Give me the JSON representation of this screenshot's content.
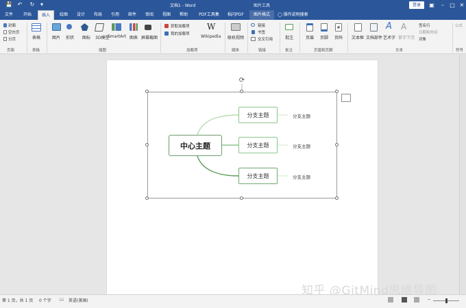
{
  "window": {
    "doc_title": "文档1 - Word",
    "tools_title": "图片工具",
    "login_label": "登录"
  },
  "tabs": [
    "文件",
    "开始",
    "插入",
    "绘图",
    "设计",
    "布局",
    "引用",
    "邮件",
    "审阅",
    "视图",
    "帮助",
    "PDF工具集",
    "稻闪PDF",
    "图片格式",
    "操作说明搜索"
  ],
  "ribbon": {
    "pages": {
      "cover": "封面",
      "blank": "空白页",
      "break": "分页",
      "label": "页面"
    },
    "tables": {
      "table": "表格",
      "label": "表格"
    },
    "illustrations": {
      "picture": "图片",
      "shapes": "形状",
      "icons": "图标",
      "model3d": "3D模型",
      "smartart": "SmartArt",
      "chart": "图表",
      "screenshot": "屏幕截图",
      "label": "插图"
    },
    "addins": {
      "get": "获取加载项",
      "mine": "我的加载项",
      "wiki": "Wikipedia",
      "label": "加载项"
    },
    "media": {
      "video": "联机视频",
      "label": "媒体"
    },
    "links": {
      "link": "链接",
      "bookmark": "书签",
      "crossref": "交叉引用",
      "label": "链接"
    },
    "comments": {
      "comment": "批注",
      "label": "批注"
    },
    "header_footer": {
      "header": "页眉",
      "footer": "页脚",
      "page_number": "页码",
      "label": "页眉和页脚"
    },
    "text": {
      "textbox": "文本框",
      "quickparts": "文档部件",
      "wordart": "艺术字",
      "dropcap": "首字下沉",
      "signature": "签名行",
      "datetime": "日期和时间",
      "object": "对象",
      "label": "文本"
    },
    "symbols": {
      "formula": "公式",
      "label": "符号"
    }
  },
  "mindmap": {
    "center": "中心主题",
    "branches": [
      "分支主题",
      "分支主题",
      "分支主题"
    ],
    "subtopics": [
      "分支主题",
      "分支主题",
      "分支主题"
    ]
  },
  "watermark": "知乎 @GitMind思维导图",
  "status": {
    "page": "第 1 页，共 1 页",
    "words": "0 个字",
    "lang": "英语(美国)"
  }
}
